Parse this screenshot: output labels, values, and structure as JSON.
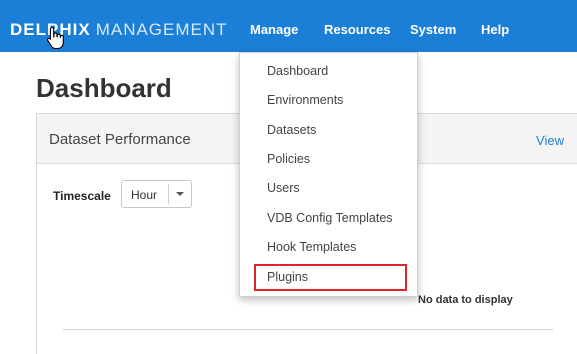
{
  "navbar": {
    "brand_strong": "DELPHIX",
    "brand_light": "MANAGEMENT",
    "links": [
      "Manage",
      "Resources",
      "System",
      "Help"
    ],
    "background_color": "#1b7fd8"
  },
  "page": {
    "title": "Dashboard"
  },
  "panel": {
    "title": "Dataset Performance",
    "view_link": "View",
    "timescale_label": "Timescale",
    "timescale_value": "Hour",
    "empty_message": "No data to display"
  },
  "manage_menu": {
    "items": [
      "Dashboard",
      "Environments",
      "Datasets",
      "Policies",
      "Users",
      "VDB Config Templates",
      "Hook Templates",
      "Plugins"
    ],
    "highlighted_item": "Plugins",
    "highlight_color": "#e0242a"
  },
  "icons": {
    "cursor": "hand-pointer-icon",
    "dropdown_caret": "caret-down-icon"
  }
}
